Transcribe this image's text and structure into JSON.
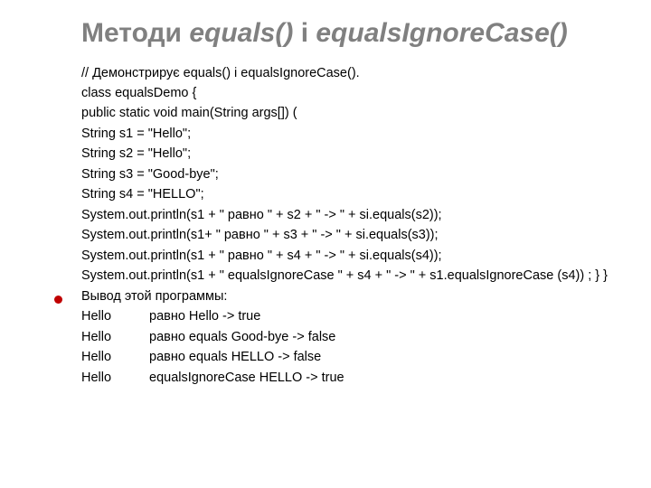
{
  "title": {
    "prefix": "Методи ",
    "m1": "equals()",
    "mid": " і ",
    "m2": "equalsIgnoreCase()"
  },
  "code": [
    "// Демонстрирує equals() і equalsIgnoreCase().",
    "class equalsDemo {",
    "public static void main(String args[]) (",
    "String s1 = \"Hello\";",
    "String s2 = \"Hello\";",
    "String s3 = \"Good-bye\";",
    "String s4 = \"HELLO\";",
    "System.out.println(s1 + \" равно \" + s2 + \" -> \" + si.equals(s2));",
    "System.out.println(s1+ \" равно \" + s3 + \" -> \" + si.equals(s3));",
    "System.out.println(s1 + \" равно \" + s4 + \" -> \" + si.equals(s4));",
    "System.out.println(s1 + \" equalsIgnoreCase \" + s4 + \" -> \" + s1.equalsIgnoreCase (s4)) ; } }"
  ],
  "bullet_label": "Вывод этой программы:",
  "output": [
    {
      "c1": "Hello",
      "c2": "равно Hello -> true"
    },
    {
      "c1": "Hello",
      "c2": "равно equals Good-bye -> false"
    },
    {
      "c1": "Hello",
      "c2": "равно equals HELLO -> false"
    },
    {
      "c1": "Hello",
      "c2": "equalsIgnoreCase HELLO -> true"
    }
  ]
}
